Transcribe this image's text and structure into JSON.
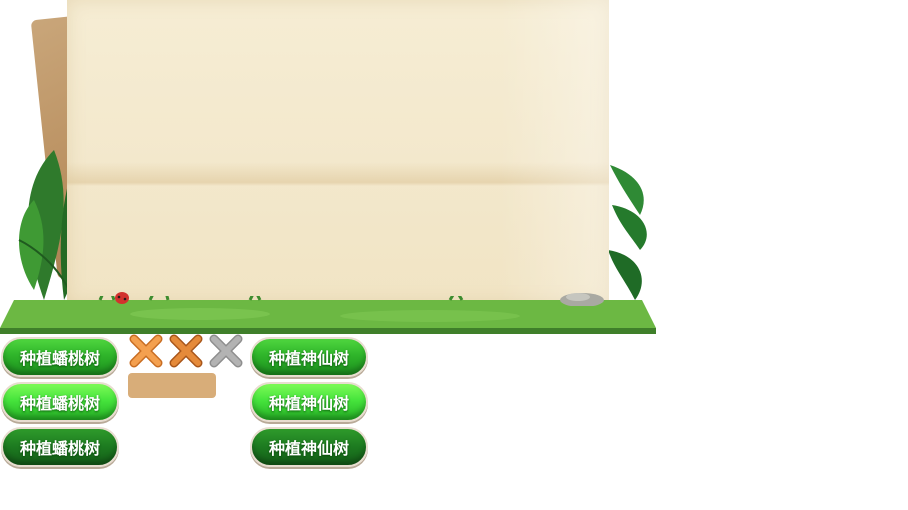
{
  "colors": {
    "paper": "#f3e8cc",
    "grass": "#5fae3a",
    "button_green": "#2fb52a",
    "x_orange": "#f39a4a",
    "x_orange_dark": "#e07f2e",
    "x_gray": "#a8a8a8",
    "bar": "#d8ad79"
  },
  "buttons": {
    "peach": [
      {
        "label": "种植蟠桃树",
        "state": "normal"
      },
      {
        "label": "种植蟠桃树",
        "state": "hover"
      },
      {
        "label": "种植蟠桃树",
        "state": "pressed"
      }
    ],
    "immortal": [
      {
        "label": "种植神仙树",
        "state": "normal"
      },
      {
        "label": "种植神仙树",
        "state": "hover"
      },
      {
        "label": "种植神仙树",
        "state": "pressed"
      }
    ]
  },
  "close_icons": [
    {
      "icon": "close-icon",
      "state": "normal"
    },
    {
      "icon": "close-icon",
      "state": "hover"
    },
    {
      "icon": "close-icon",
      "state": "disabled"
    }
  ]
}
